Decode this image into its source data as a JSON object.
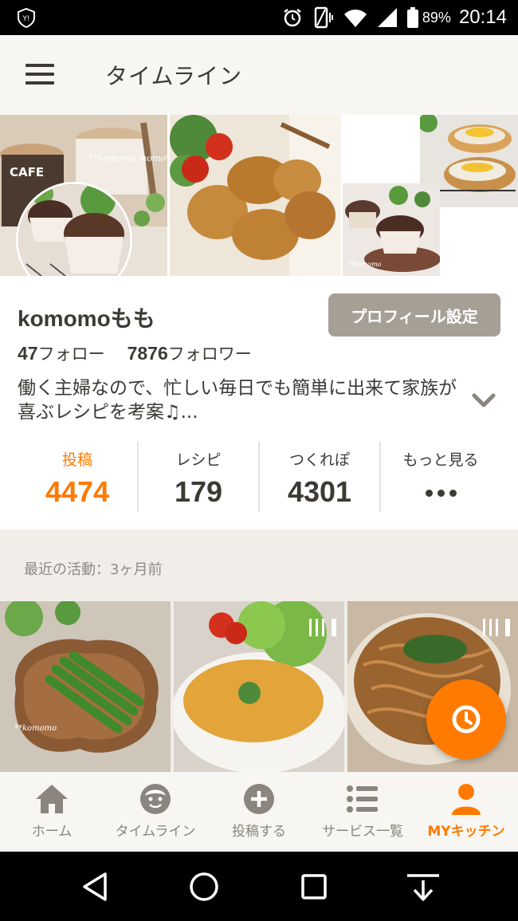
{
  "status_bar": {
    "battery": "89%",
    "time": "20:14",
    "icons": [
      "shield-icon",
      "alarm-icon",
      "vibrate-icon",
      "wifi-icon",
      "signal-icon",
      "battery-icon"
    ]
  },
  "header": {
    "title": "タイムライン",
    "menu_icon": "hamburger-menu-icon"
  },
  "banner": {
    "watermark": "**komomo momo**",
    "cafe_text": "CAFE"
  },
  "profile": {
    "username": "komomoもも",
    "settings_button": "プロフィール設定",
    "follow_count": "47",
    "follow_label": "フォロー",
    "follower_count": "7876",
    "follower_label": "フォロワー",
    "bio": "働く主婦なので、忙しい毎日でも簡単に出来て家族が喜ぶレシピを考案♫..."
  },
  "stats": [
    {
      "label": "投稿",
      "value": "4474",
      "active": true
    },
    {
      "label": "レシピ",
      "value": "179"
    },
    {
      "label": "つくれぽ",
      "value": "4301"
    },
    {
      "label": "もっと見る",
      "value": ""
    }
  ],
  "activity": {
    "text": "最近の活動：3ヶ月前"
  },
  "bottom_nav": [
    {
      "label": "ホーム",
      "icon": "home-icon"
    },
    {
      "label": "タイムライン",
      "icon": "face-icon"
    },
    {
      "label": "投稿する",
      "icon": "plus-circle-icon"
    },
    {
      "label": "サービス一覧",
      "icon": "list-icon"
    },
    {
      "label": "MYキッチン",
      "icon": "person-icon",
      "active": true
    }
  ],
  "colors": {
    "accent": "#ff7a00",
    "header_bg": "#f8f6f2",
    "button_gray": "#a59f96",
    "text": "#3d3a35"
  }
}
